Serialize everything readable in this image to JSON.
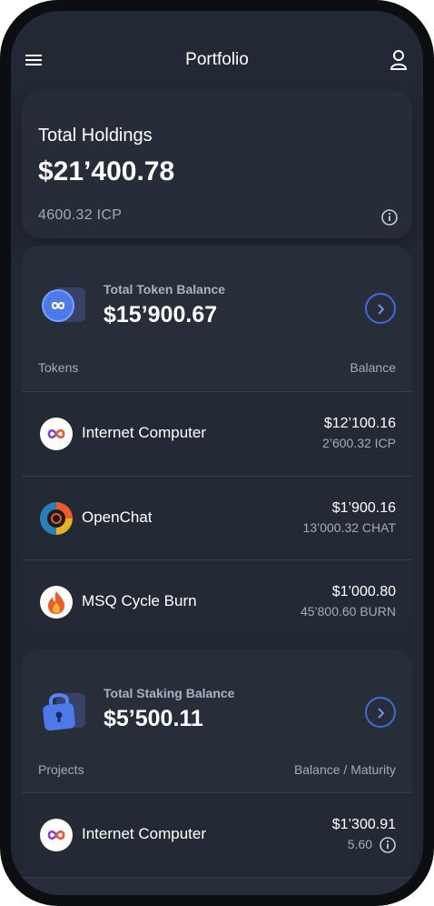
{
  "header": {
    "title": "Portfolio"
  },
  "holdings": {
    "title": "Total Holdings",
    "value": "$21’400.78",
    "icp": "4600.32  ICP"
  },
  "tokens": {
    "label": "Total Token Balance",
    "value": "$15’900.67",
    "col_left": "Tokens",
    "col_right": "Balance",
    "rows": [
      {
        "name": "Internet Computer",
        "amount": "$12’100.16",
        "sub": "2’600.32 ICP",
        "icon": "internet-computer-logo"
      },
      {
        "name": "OpenChat",
        "amount": "$1’900.16",
        "sub": "13’000.32 CHAT",
        "icon": "openchat-logo"
      },
      {
        "name": "MSQ Cycle Burn",
        "amount": "$1’000.80",
        "sub": "45’800.60 BURN",
        "icon": "fire-logo"
      }
    ]
  },
  "staking": {
    "label": "Total Staking Balance",
    "value": "$5’500.11",
    "col_left": "Projects",
    "col_right": "Balance / Maturity",
    "rows": [
      {
        "name": "Internet Computer",
        "amount": "$1’300.91",
        "sub": "5.60",
        "icon": "internet-computer-logo"
      }
    ]
  },
  "colors": {
    "accent": "#3f6bd9",
    "background": "#222833",
    "card": "#272e3a"
  }
}
